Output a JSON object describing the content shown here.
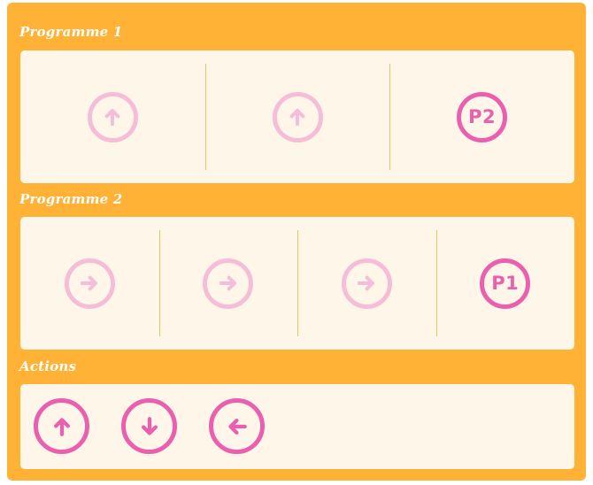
{
  "programme1": {
    "title": "Programme 1",
    "slots": [
      {
        "icon": "arrow-up-icon",
        "state": "filled"
      },
      {
        "icon": "arrow-up-icon",
        "state": "filled"
      },
      {
        "icon": "call-procedure-icon",
        "label": "P2",
        "state": "procedure"
      }
    ]
  },
  "programme2": {
    "title": "Programme 2",
    "slots": [
      {
        "icon": "arrow-right-icon",
        "state": "filled"
      },
      {
        "icon": "arrow-right-icon",
        "state": "filled"
      },
      {
        "icon": "arrow-right-icon",
        "state": "filled"
      },
      {
        "icon": "call-procedure-icon",
        "label": "P1",
        "state": "procedure"
      }
    ]
  },
  "actions": {
    "title": "Actions",
    "buttons": [
      {
        "icon": "arrow-up-icon"
      },
      {
        "icon": "arrow-down-icon"
      },
      {
        "icon": "arrow-left-icon"
      }
    ]
  },
  "colors": {
    "panel": "#ffb236",
    "box": "#fff6ea",
    "accent": "#ea5fae",
    "accent_light": "#f6bdd8",
    "divider": "#f0c15a"
  }
}
